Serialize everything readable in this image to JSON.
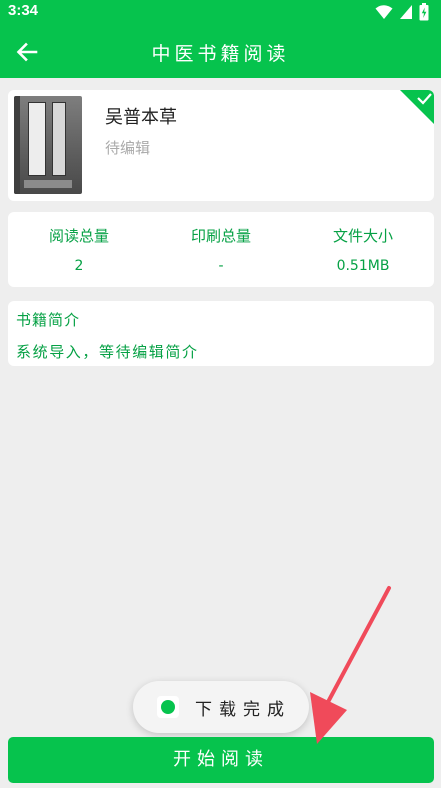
{
  "status_bar": {
    "time": "3:34",
    "icons": [
      "wifi-icon",
      "signal-icon",
      "battery-icon"
    ]
  },
  "app_bar": {
    "title": "中医书籍阅读",
    "back_icon": "arrow-left-icon"
  },
  "book": {
    "title": "吴普本草",
    "author": "待编辑",
    "downloaded_badge": "check-icon"
  },
  "stats": [
    {
      "label": "阅读总量",
      "value": "2"
    },
    {
      "label": "印刷总量",
      "value": "-"
    },
    {
      "label": "文件大小",
      "value": "0.51MB"
    }
  ],
  "intro": {
    "title": "书籍简介",
    "text": "系统导入，等待编辑简介"
  },
  "toast": {
    "text": "下载完成"
  },
  "actions": {
    "start_label": "开始阅读"
  },
  "colors": {
    "accent": "#06c34d",
    "accent_text": "#06a145",
    "background": "#eeeeee",
    "annotation_arrow": "#f04a5a"
  }
}
